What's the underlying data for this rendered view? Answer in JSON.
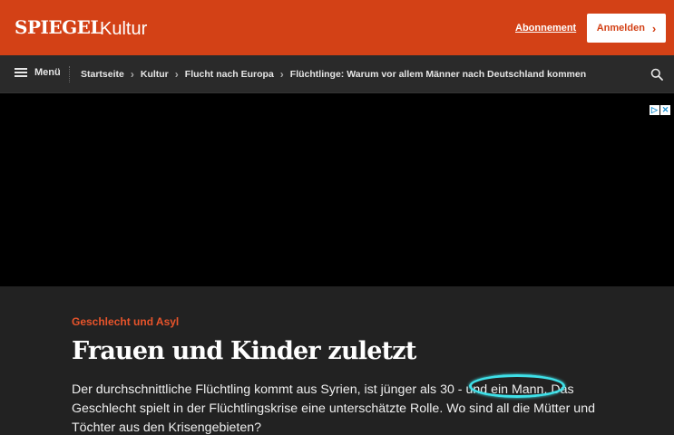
{
  "header": {
    "brand": "SPIEGEL",
    "section": "Kultur",
    "subscribe_label": "Abonnement",
    "login_label": "Anmelden",
    "colors": {
      "brand": "#d34116"
    }
  },
  "nav": {
    "menu_label": "Menü",
    "breadcrumbs": [
      "Startseite",
      "Kultur",
      "Flucht nach Europa",
      "Flüchtlinge: Warum vor allem Männer nach Deutschland kommen"
    ]
  },
  "article": {
    "kicker": "Geschlecht und Asyl",
    "headline": "Frauen und Kinder zuletzt",
    "teaser": "Der durchschnittliche Flüchtling kommt aus Syrien, ist jünger als 30 - und ein Mann. Das Geschlecht spielt in der Flüchtlingskrise eine unterschätzte Rolle. Wo sind all die Mütter und Töchter aus den Krisengebieten?"
  }
}
